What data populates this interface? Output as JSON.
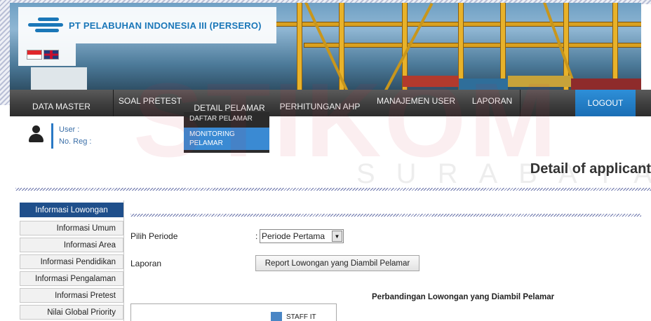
{
  "header": {
    "company_name": "PT PELABUHAN INDONESIA III (PERSERO)",
    "languages": [
      "indonesia-flag-icon",
      "uk-flag-icon"
    ]
  },
  "menu": {
    "items": [
      {
        "label": "DATA MASTER"
      },
      {
        "label": "SOAL PRETEST"
      },
      {
        "label": "DETAIL PELAMAR"
      },
      {
        "label": "PERHITUNGAN AHP"
      },
      {
        "label": "MANAJEMEN USER"
      },
      {
        "label": "LAPORAN"
      }
    ],
    "logout_label": "LOGOUT",
    "dropdown": {
      "items": [
        {
          "label": "DAFTAR PELAMAR"
        },
        {
          "label": "MONITORING PELAMAR"
        }
      ]
    }
  },
  "user": {
    "user_label": "User :",
    "noreg_label": "No. Reg :"
  },
  "watermark": {
    "big": "STIKOM",
    "small": "SURABAYA"
  },
  "page": {
    "heading": "Detail of applicant"
  },
  "sidebar": {
    "tabs": [
      {
        "label": "Informasi Lowongan",
        "active": true
      },
      {
        "label": "Informasi Umum"
      },
      {
        "label": "Informasi Area"
      },
      {
        "label": "Informasi Pendidikan"
      },
      {
        "label": "Informasi Pengalaman"
      },
      {
        "label": "Informasi Pretest"
      },
      {
        "label": "Nilai Global Priority"
      }
    ]
  },
  "form": {
    "periode_label": "Pilih Periode",
    "periode_value": "Periode Pertama",
    "laporan_label": "Laporan",
    "report_button": "Report Lowongan yang Diambil Pelamar"
  },
  "chart": {
    "title": "Perbandingan Lowongan yang Diambil Pelamar",
    "legend": [
      "STAFF IT"
    ]
  },
  "colors": {
    "accent_blue": "#1a77b8",
    "active_tab": "#1f4f8b",
    "menubar": "#3e3e3e",
    "logout": "#1a6eb5"
  }
}
